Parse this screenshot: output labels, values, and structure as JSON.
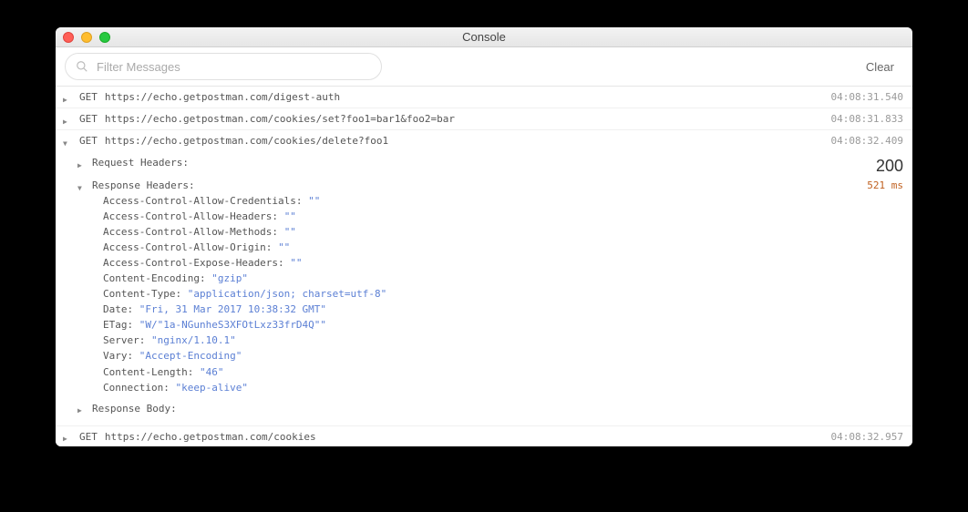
{
  "window": {
    "title": "Console"
  },
  "toolbar": {
    "search_placeholder": "Filter Messages",
    "clear_label": "Clear"
  },
  "logs": [
    {
      "method": "GET",
      "url": "https://echo.getpostman.com/digest-auth",
      "time": "04:08:31.540"
    },
    {
      "method": "GET",
      "url": "https://echo.getpostman.com/cookies/set?foo1=bar1&foo2=bar",
      "time": "04:08:31.833"
    },
    {
      "method": "GET",
      "url": "https://echo.getpostman.com/cookies/delete?foo1",
      "time": "04:08:32.409"
    },
    {
      "method": "GET",
      "url": "https://echo.getpostman.com/cookies",
      "time": "04:08:32.957"
    }
  ],
  "expanded": {
    "request_headers_label": "Request Headers:",
    "response_headers_label": "Response Headers:",
    "response_body_label": "Response Body:",
    "status": "200",
    "latency": "521 ms",
    "headers": [
      {
        "k": "Access-Control-Allow-Credentials:",
        "v": "\"\""
      },
      {
        "k": "Access-Control-Allow-Headers:",
        "v": "\"\""
      },
      {
        "k": "Access-Control-Allow-Methods:",
        "v": "\"\""
      },
      {
        "k": "Access-Control-Allow-Origin:",
        "v": "\"\""
      },
      {
        "k": "Access-Control-Expose-Headers:",
        "v": "\"\""
      },
      {
        "k": "Content-Encoding:",
        "v": "\"gzip\""
      },
      {
        "k": "Content-Type:",
        "v": "\"application/json; charset=utf-8\""
      },
      {
        "k": "Date:",
        "v": "\"Fri, 31 Mar 2017 10:38:32 GMT\""
      },
      {
        "k": "ETag:",
        "v": "\"W/\"1a-NGunheS3XFOtLxz33frD4Q\"\""
      },
      {
        "k": "Server:",
        "v": "\"nginx/1.10.1\""
      },
      {
        "k": "Vary:",
        "v": "\"Accept-Encoding\""
      },
      {
        "k": "Content-Length:",
        "v": "\"46\""
      },
      {
        "k": "Connection:",
        "v": "\"keep-alive\""
      }
    ]
  }
}
